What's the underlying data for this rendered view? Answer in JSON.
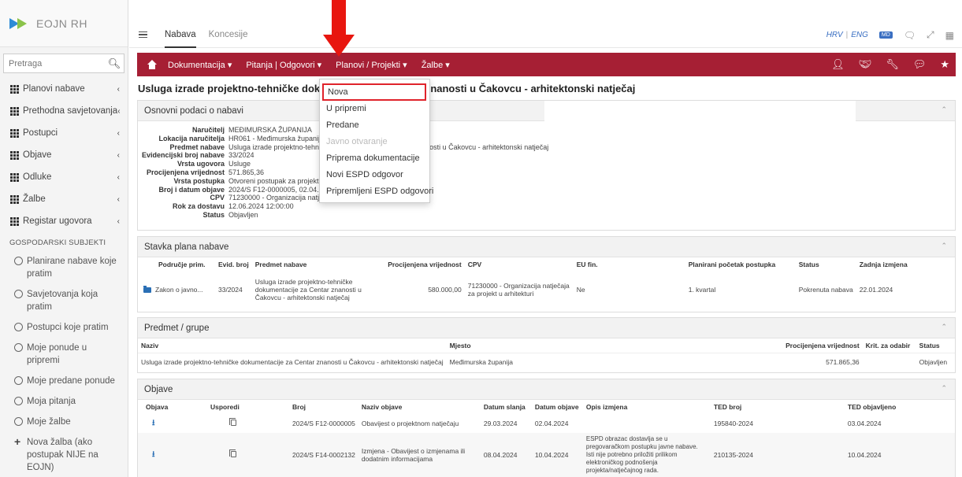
{
  "app": {
    "logo_text": "EOJN RH"
  },
  "search": {
    "placeholder": "Pretraga"
  },
  "sidebar": {
    "items": [
      {
        "label": "Planovi nabave"
      },
      {
        "label": "Prethodna savjetovanja"
      },
      {
        "label": "Postupci"
      },
      {
        "label": "Objave"
      },
      {
        "label": "Odluke"
      },
      {
        "label": "Žalbe"
      },
      {
        "label": "Registar ugovora"
      }
    ],
    "section_title": "GOSPODARSKI SUBJEKTI",
    "sub_items": [
      {
        "label": "Planirane nabave koje pratim"
      },
      {
        "label": "Savjetovanja koja pratim"
      },
      {
        "label": "Postupci koje pratim"
      },
      {
        "label": "Moje ponude u pripremi"
      },
      {
        "label": "Moje predane ponude"
      },
      {
        "label": "Moja pitanja"
      },
      {
        "label": "Moje žalbe"
      }
    ],
    "new_complaint": "Nova žalba (ako postupak NIJE na EOJN)"
  },
  "topbar": {
    "tabs": [
      "Nabava",
      "Koncesije"
    ],
    "lang_hr": "HRV",
    "lang_sep": "|",
    "lang_en": "ENG",
    "badge": "MD"
  },
  "menubar": {
    "items": [
      "Dokumentacija ▾",
      "Pitanja | Odgovori ▾",
      "Planovi / Projekti ▾",
      "Žalbe ▾"
    ]
  },
  "page": {
    "title": "Usluga izrade projektno-tehničke dokumentacije za Centar znanosti u Čakovcu - arhitektonski natječaj"
  },
  "dropdown": {
    "items": [
      {
        "label": "Nova",
        "disabled": false
      },
      {
        "label": "U pripremi",
        "disabled": false
      },
      {
        "label": "Predane",
        "disabled": false
      },
      {
        "label": "Javno otvaranje",
        "disabled": true
      },
      {
        "label": "Priprema dokumentacije",
        "disabled": false
      },
      {
        "label": "Novi ESPD odgovor",
        "disabled": false
      },
      {
        "label": "Pripremljeni ESPD odgovori",
        "disabled": false
      }
    ]
  },
  "basic_info": {
    "header": "Osnovni podaci o nabavi",
    "rows": [
      {
        "k": "Naručitelj",
        "v": "MEĐIMURSKA ŽUPANIJA"
      },
      {
        "k": "Lokacija naručitelja",
        "v": "HR061 - Međimurska županija"
      },
      {
        "k": "Predmet nabave",
        "v": "Usluga izrade projektno-tehničke dokumentacije za Centar znanosti u Čakovcu - arhitektonski natječaj"
      },
      {
        "k": "Evidencijski broj nabave",
        "v": "33/2024"
      },
      {
        "k": "Vrsta ugovora",
        "v": "Usluge"
      },
      {
        "k": "Procijenjena vrijednost",
        "v": "571.865,36"
      },
      {
        "k": "Vrsta postupka",
        "v": "Otvoreni postupak za projektni natječaj"
      },
      {
        "k": "Broj i datum objave",
        "v": "2024/S F12-0000005, 02.04.2024"
      },
      {
        "k": "CPV",
        "v": "71230000 - Organizacija natječaja za projekt u arhitekturi"
      },
      {
        "k": "Rok za dostavu",
        "v": "12.06.2024 12:00:00"
      },
      {
        "k": "Status",
        "v": "Objavljen"
      }
    ]
  },
  "plan": {
    "header": "Stavka plana nabave",
    "columns": [
      "Područje prim.",
      "Evid. broj",
      "Predmet nabave",
      "Procijenjena vrijednost",
      "CPV",
      "EU fin.",
      "Planirani početak postupka",
      "Status",
      "Zadnja izmjena"
    ],
    "row": {
      "area": "Zakon o javno...",
      "evid": "33/2024",
      "subject": "Usluga izrade projektno-tehničke dokumentacije za Centar znanosti u Čakovcu - arhitektonski natječaj",
      "value": "580.000,00",
      "cpv": "71230000 - Organizacija natječaja za projekt u arhitekturi",
      "eu": "Ne",
      "start": "1. kvartal",
      "status": "Pokrenuta nabava",
      "changed": "22.01.2024"
    }
  },
  "groups": {
    "header": "Predmet / grupe",
    "columns": [
      "Naziv",
      "Mjesto",
      "Procijenjena vrijednost",
      "Krit. za odabir",
      "Status"
    ],
    "row": {
      "name": "Usluga izrade projektno-tehničke dokumentacije za Centar znanosti u Čakovcu - arhitektonski natječaj",
      "place": "Međimurska županija",
      "value": "571.865,36",
      "criteria": "",
      "status": "Objavljen"
    }
  },
  "notices": {
    "header": "Objave",
    "columns": [
      "Objava",
      "Usporedi",
      "Broj",
      "Naziv objave",
      "Datum slanja",
      "Datum objave",
      "Opis izmjena",
      "TED broj",
      "TED objavljeno"
    ],
    "rows": [
      {
        "broj": "2024/S F12-0000005",
        "naziv": "Obavijest o projektnom natječaju",
        "sent": "29.03.2024",
        "published": "02.04.2024",
        "desc": "",
        "ted": "195840-2024",
        "ted_pub": "03.04.2024"
      },
      {
        "broj": "2024/S F14-0002132",
        "naziv": "Izmjena - Obavijest o izmjenama ili dodatnim informacijama",
        "sent": "08.04.2024",
        "published": "10.04.2024",
        "desc": "ESPD obrazac dostavlja se u pregovaračkom postupku javne nabave. Isti nije potrebno priložiti prilikom elektroničkog podnošenja projekta/natječajnog rada.",
        "ted": "210135-2024",
        "ted_pub": "10.04.2024"
      }
    ]
  },
  "colors": {
    "accent": "#a61f34",
    "arrow": "#e8160f",
    "link": "#2a6fb5"
  }
}
